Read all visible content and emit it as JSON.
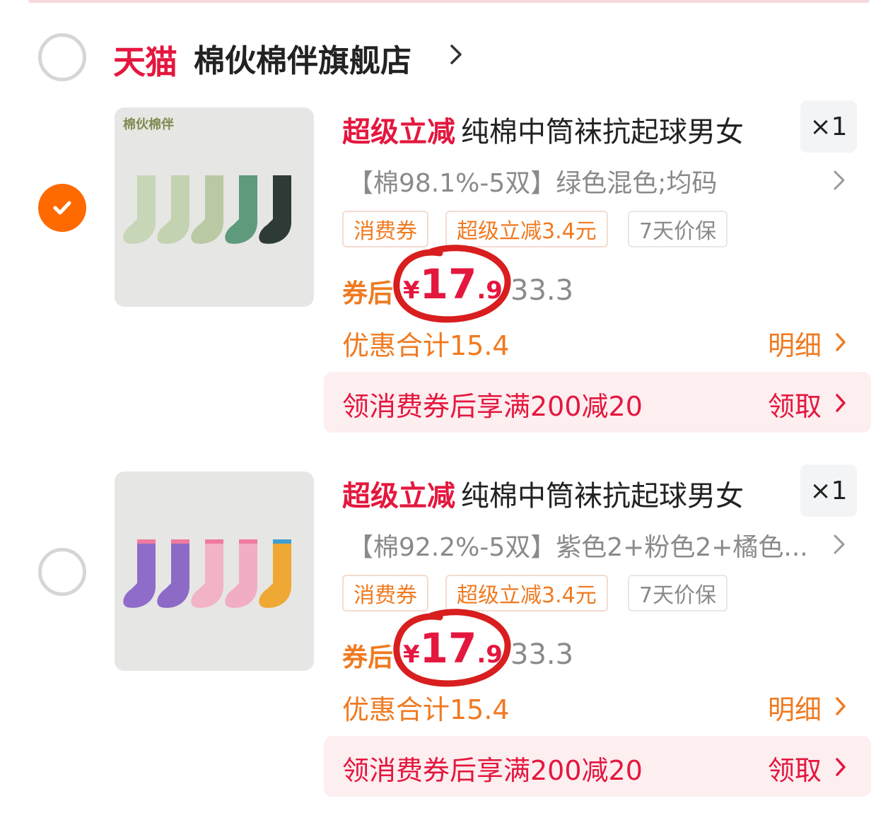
{
  "shop": {
    "platform_label": "天猫",
    "name": "棉伙棉伴旗舰店",
    "selected": false
  },
  "items": [
    {
      "selected": true,
      "thumb_brand": "棉伙棉伴",
      "sock_colors": [
        "#c7d6b6",
        "#c3d3b1",
        "#b9c9a4",
        "#5e9a7c",
        "#2e3a35"
      ],
      "promo_label": "超级立减",
      "name": "纯棉中筒袜抗起球男女",
      "quantity": "×1",
      "sku": "【棉98.1%-5双】绿色混色;均码",
      "tags": [
        "消费券",
        "超级立减3.4元",
        "7天价保"
      ],
      "after_label": "券后",
      "price_yen": "¥",
      "price_int": "17",
      "price_dec": ".9",
      "original_price": "33.3",
      "discount_text": "优惠合计15.4",
      "detail_label": "明细",
      "coupon_text": "领消费券后享满200减20",
      "claim_label": "领取"
    },
    {
      "selected": false,
      "thumb_brand": "",
      "sock_colors": [
        "#8f6cc9",
        "#8d6ac6",
        "#f2b3c6",
        "#f1adc3",
        "#efa833"
      ],
      "promo_label": "超级立减",
      "name": "纯棉中筒袜抗起球男女",
      "quantity": "×1",
      "sku": "【棉92.2%-5双】紫色2+粉色2+橘色...",
      "tags": [
        "消费券",
        "超级立减3.4元",
        "7天价保"
      ],
      "after_label": "券后",
      "price_yen": "¥",
      "price_int": "17",
      "price_dec": ".9",
      "original_price": "33.3",
      "discount_text": "优惠合计15.4",
      "detail_label": "明细",
      "coupon_text": "领消费券后享满200减20",
      "claim_label": "领取"
    }
  ],
  "colors": {
    "accent_red": "#e4173e",
    "accent_orange": "#f07a20",
    "checkbox_orange": "#ff6a00",
    "annotation_red": "#d81e1e"
  }
}
